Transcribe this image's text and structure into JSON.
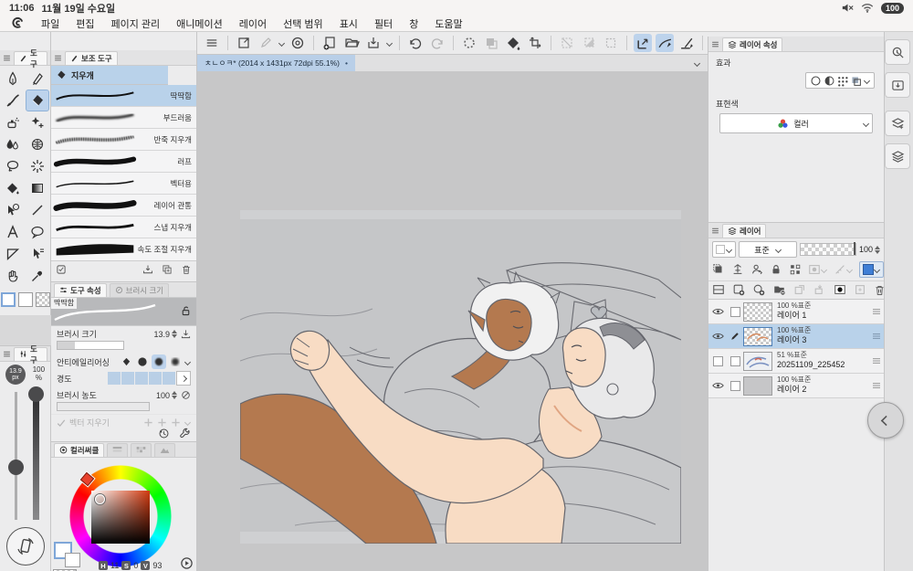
{
  "colors": {
    "accent": "#bdd3ec",
    "selection": "#b9d2ea",
    "workspace": "#c7c7c8",
    "panel": "#ececed",
    "skin_dark": "#b4794f",
    "skin_light": "#f8dcc4",
    "line": "#64656c"
  },
  "menubar": {
    "time": "11:06",
    "date": "11월 19일 수요일",
    "battery": "100"
  },
  "appmenu": {
    "items": [
      "파일",
      "편집",
      "페이지 관리",
      "애니메이션",
      "레이어",
      "선택 범위",
      "표시",
      "필터",
      "창",
      "도움말"
    ]
  },
  "doc_tab": {
    "title": "ㅊㄴㅇㅋ* (2014 x 1431px 72dpi 55.1%)",
    "modified_dot": "•"
  },
  "tool_palette": {
    "title": "도구"
  },
  "subtool": {
    "title": "보조 도구",
    "group": "지우개",
    "items": [
      "딱딱함",
      "부드러움",
      "반죽 지우개",
      "러프",
      "벡터용",
      "레이어 관통",
      "스냅 지우개",
      "속도 조절 지우개"
    ],
    "selected": "딱딱함"
  },
  "tool_property": {
    "title": "도구 속성",
    "tab2": "브러시 크기",
    "tool_name": "딱딱함",
    "brush_size_label": "브러시 크기",
    "brush_size": "13.9",
    "aa_label": "안티에일리어싱",
    "hardness_label": "경도",
    "density_label": "브러시 농도",
    "density": "100",
    "vector_label": "벡터 지우기"
  },
  "brush_hud": {
    "title": "도구",
    "size": "13.9",
    "size_unit": "px",
    "opacity": "100",
    "opacity_unit": "%"
  },
  "color_panel": {
    "tab": "컬러써클",
    "h_label": "H",
    "h": "11",
    "s_label": "S",
    "s": "0",
    "v_label": "V",
    "v": "93"
  },
  "layer_property": {
    "title": "레이어 속성",
    "effect_label": "효과",
    "expression_label": "표현색",
    "expression_value": "컬러"
  },
  "layers": {
    "title": "레이어",
    "blend_mode": "표준",
    "opacity": "100",
    "rows": [
      {
        "info": "100 %표준",
        "name": "레이어 1"
      },
      {
        "info": "100 %표준",
        "name": "레이어 3"
      },
      {
        "info": "51 %표준",
        "name": "20251109_225452"
      },
      {
        "info": "100 %표준",
        "name": "레이어 2"
      }
    ]
  }
}
